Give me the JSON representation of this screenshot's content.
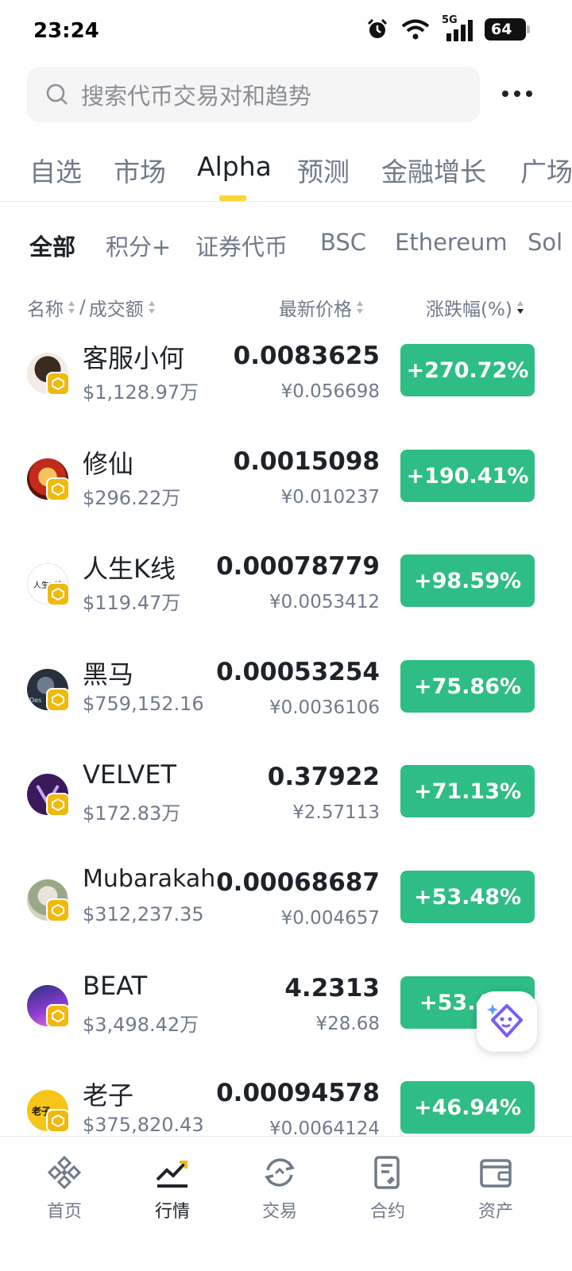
{
  "status_bar": {
    "time": "23:24",
    "network": "5G",
    "battery": "64"
  },
  "search": {
    "placeholder": "搜索代币交易对和趋势",
    "icon": "search-icon"
  },
  "main_tabs": [
    {
      "label": "自选",
      "active": false
    },
    {
      "label": "市场",
      "active": false
    },
    {
      "label": "Alpha",
      "active": true
    },
    {
      "label": "预测",
      "active": false
    },
    {
      "label": "金融增长",
      "active": false
    },
    {
      "label": "广场",
      "active": false
    }
  ],
  "sub_tabs": [
    {
      "label": "全部",
      "active": true
    },
    {
      "label": "积分+",
      "active": false
    },
    {
      "label": "证券代币",
      "active": false
    },
    {
      "label": "BSC",
      "active": false
    },
    {
      "label": "Ethereum",
      "active": false
    },
    {
      "label": "Sol",
      "active": false
    }
  ],
  "columns": {
    "name": "名称",
    "separator": "/",
    "volume": "成交额",
    "price": "最新价格",
    "change": "涨跌幅(%)"
  },
  "rows": [
    {
      "name": "客服小何",
      "volume": "$1,128.97万",
      "price": "0.0083625",
      "fiat": "¥0.056698",
      "change": "+270.72%"
    },
    {
      "name": "修仙",
      "volume": "$296.22万",
      "price": "0.0015098",
      "fiat": "¥0.010237",
      "change": "+190.41%"
    },
    {
      "name": "人生K线",
      "volume": "$119.47万",
      "price": "0.00078779",
      "fiat": "¥0.0053412",
      "change": "+98.59%"
    },
    {
      "name": "黑马",
      "volume": "$759,152.16",
      "price": "0.00053254",
      "fiat": "¥0.0036106",
      "change": "+75.86%"
    },
    {
      "name": "VELVET",
      "volume": "$172.83万",
      "price": "0.37922",
      "fiat": "¥2.57113",
      "change": "+71.13%"
    },
    {
      "name": "Mubarakah",
      "volume": "$312,237.35",
      "price": "0.00068687",
      "fiat": "¥0.004657",
      "change": "+53.48%"
    },
    {
      "name": "BEAT",
      "volume": "$3,498.42万",
      "price": "4.2313",
      "fiat": "¥28.68",
      "change": "+53.4"
    },
    {
      "name": "老子",
      "volume": "$375,820.43",
      "price": "0.00094578",
      "fiat": "¥0.0064124",
      "change": "+46.94%"
    }
  ],
  "avatar_texts": {
    "row3": "人生K线",
    "row4": "Des",
    "row8": "老子"
  },
  "bottom_nav": [
    {
      "label": "首页",
      "icon": "binance-logo-icon",
      "active": false
    },
    {
      "label": "行情",
      "icon": "chart-trend-icon",
      "active": true
    },
    {
      "label": "交易",
      "icon": "trade-exchange-icon",
      "active": false
    },
    {
      "label": "合约",
      "icon": "contract-document-icon",
      "active": false
    },
    {
      "label": "资产",
      "icon": "wallet-icon",
      "active": false
    }
  ],
  "colors": {
    "accent": "#fcd535",
    "up": "#2ebd85",
    "text": "#1e2329",
    "muted": "#707a8a",
    "badge": "#f0b90b"
  }
}
